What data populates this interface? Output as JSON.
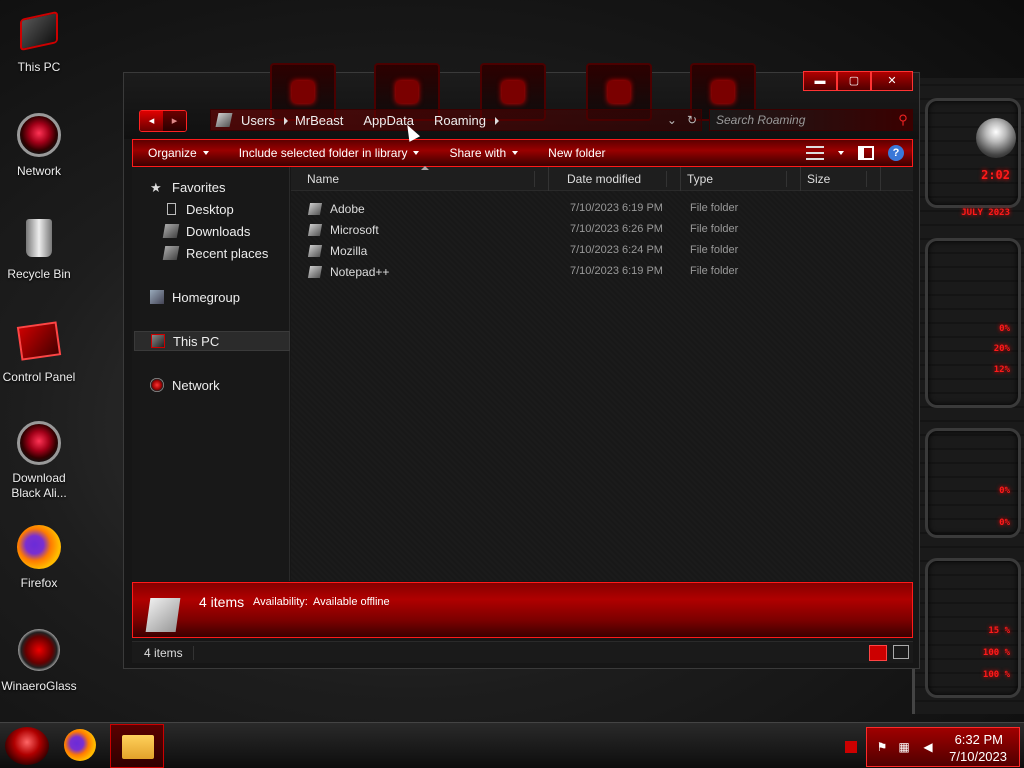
{
  "desktop": {
    "icons": [
      {
        "label": "This PC"
      },
      {
        "label": "Network"
      },
      {
        "label": "Recycle Bin"
      },
      {
        "label": "Control Panel"
      },
      {
        "label": "Download Black Ali..."
      },
      {
        "label": "Firefox"
      },
      {
        "label": "WinaeroGlass"
      }
    ]
  },
  "window": {
    "controls": {
      "minimize": "▬",
      "maximize": "▢",
      "close": "✕"
    },
    "nav": {
      "back": "◂",
      "forward": "▸"
    },
    "breadcrumb": [
      "Users",
      "MrBeast",
      "AppData",
      "Roaming"
    ],
    "search": {
      "placeholder": "Search Roaming"
    },
    "toolbar": {
      "organize": "Organize",
      "include": "Include selected folder in library",
      "share": "Share with",
      "new_folder": "New folder"
    },
    "navpane": {
      "favorites": "Favorites",
      "desktop": "Desktop",
      "downloads": "Downloads",
      "recent": "Recent places",
      "homegroup": "Homegroup",
      "this_pc": "This PC",
      "network": "Network"
    },
    "columns": {
      "name": "Name",
      "date": "Date modified",
      "type": "Type",
      "size": "Size"
    },
    "files": [
      {
        "name": "Adobe",
        "date": "7/10/2023 6:19 PM",
        "type": "File folder"
      },
      {
        "name": "Microsoft",
        "date": "7/10/2023 6:26 PM",
        "type": "File folder"
      },
      {
        "name": "Mozilla",
        "date": "7/10/2023 6:24 PM",
        "type": "File folder"
      },
      {
        "name": "Notepad++",
        "date": "7/10/2023 6:19 PM",
        "type": "File folder"
      }
    ],
    "details": {
      "count": "4 items",
      "availability_label": "Availability:",
      "availability_value": "Available offline"
    },
    "status": {
      "text": "4 items"
    }
  },
  "gadget": {
    "readouts": [
      "2:02",
      "JULY 2023",
      "0%",
      "20%",
      "12%",
      "0%",
      "0%",
      "15 %",
      "100 %",
      "100 %"
    ]
  },
  "taskbar": {
    "clock_time": "6:32 PM",
    "clock_date": "7/10/2023"
  },
  "colors": {
    "accent": "#b00000",
    "accent_bright": "#ff1a1a",
    "background": "#161616"
  }
}
